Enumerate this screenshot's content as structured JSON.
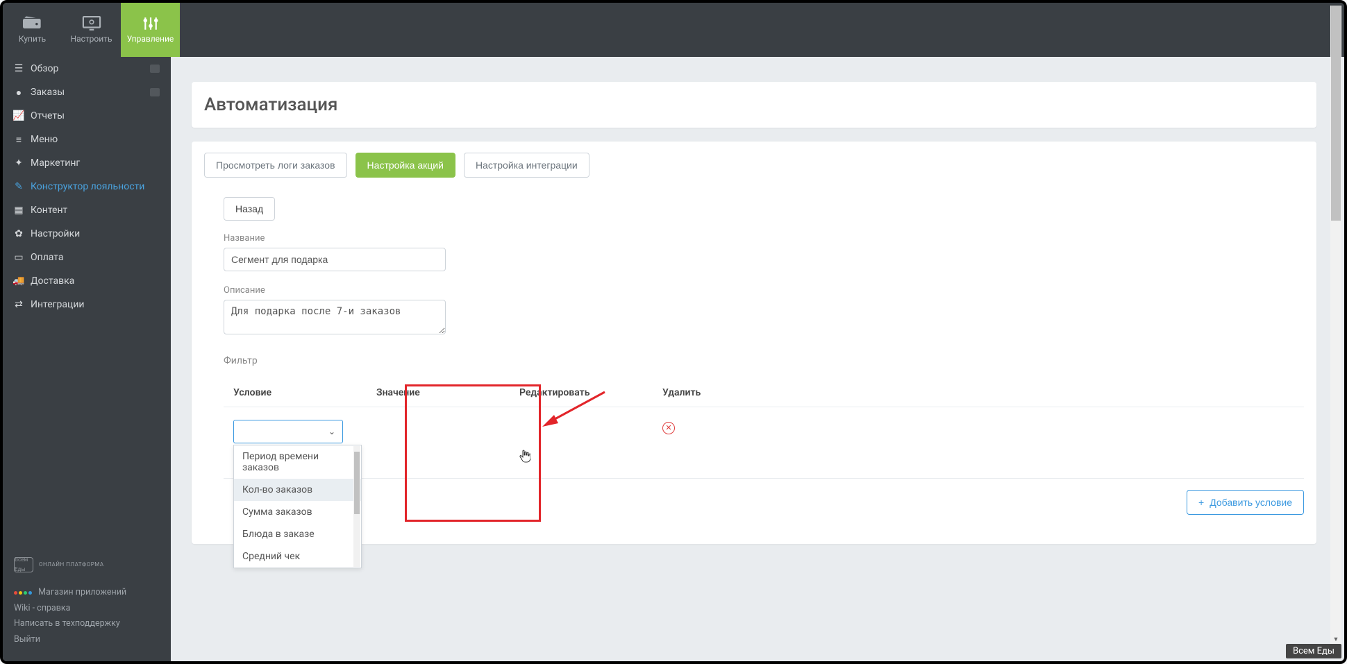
{
  "topbar": {
    "buy": "Купить",
    "setup": "Настроить",
    "manage": "Управление"
  },
  "sidebar": {
    "items": [
      {
        "label": "Обзор"
      },
      {
        "label": "Заказы"
      },
      {
        "label": "Отчеты"
      },
      {
        "label": "Меню"
      },
      {
        "label": "Маркетинг"
      },
      {
        "label": "Конструктор лояльности"
      },
      {
        "label": "Контент"
      },
      {
        "label": "Настройки"
      },
      {
        "label": "Оплата"
      },
      {
        "label": "Доставка"
      },
      {
        "label": "Интеграции"
      }
    ],
    "brand_sub": "ОНЛАЙН ПЛАТФОРМА",
    "footer": {
      "store": "Магазин приложений",
      "wiki": "Wiki - справка",
      "support": "Написать в техподдержку",
      "exit": "Выйти"
    }
  },
  "page": {
    "title": "Автоматизация"
  },
  "buttons": {
    "logs": "Просмотреть логи заказов",
    "promo": "Настройка акций",
    "integr": "Настройка интеграции",
    "back": "Назад",
    "add": "Добавить условие"
  },
  "form": {
    "name_label": "Название",
    "name_value": "Сегмент для подарка",
    "desc_label": "Описание",
    "desc_value": "Для подарка после 7-и заказов",
    "filter_label": "Фильтр"
  },
  "table": {
    "cond": "Условие",
    "val": "Значение",
    "edit": "Редактировать",
    "del": "Удалить"
  },
  "dropdown": {
    "opts": [
      "Период времени заказов",
      "Кол-во заказов",
      "Сумма заказов",
      "Блюда в заказе",
      "Средний чек"
    ]
  },
  "pill": "Всем Еды"
}
